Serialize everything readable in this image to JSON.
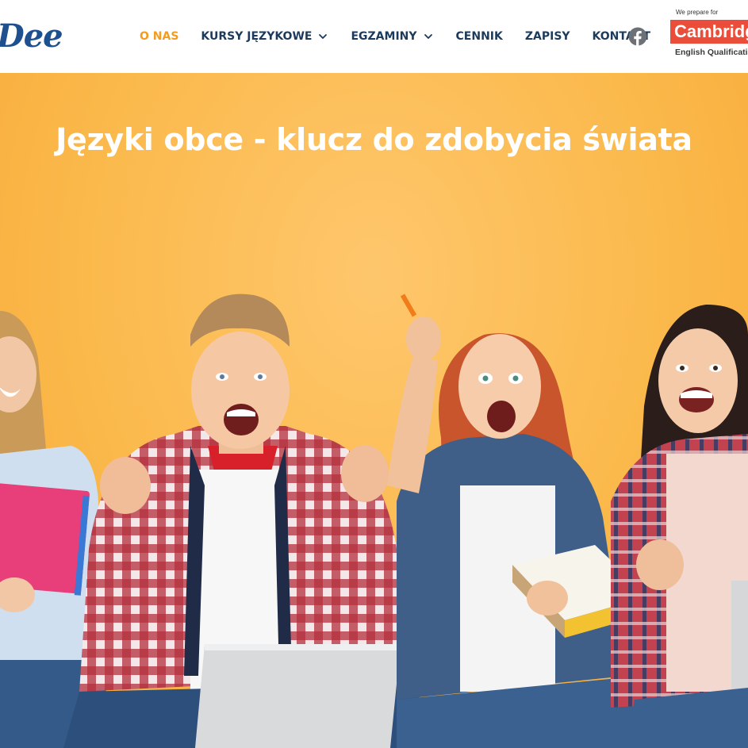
{
  "header": {
    "logo_text": "Dee",
    "nav": [
      {
        "label": "O NAS",
        "active": true
      },
      {
        "label": "KURSY JĘZYKOWE",
        "dropdown": true
      },
      {
        "label": "EGZAMINY",
        "dropdown": true
      },
      {
        "label": "CENNIK"
      },
      {
        "label": "ZAPISY"
      },
      {
        "label": "KONTAKT"
      }
    ],
    "social_icon": "facebook-icon",
    "badge": {
      "top": "We prepare for",
      "brand": "Cambridge",
      "bottom": "English Qualifications"
    }
  },
  "hero": {
    "title": "Języki obce - klucz do zdobycia świata",
    "image_description": "four excited students with notebooks and laptops"
  },
  "colors": {
    "nav_text": "#1c3a5b",
    "nav_active": "#f39c1f",
    "hero_bg": "#fbb94b",
    "cambridge_red": "#ea4d3a",
    "logo": "#1e4f8e"
  }
}
